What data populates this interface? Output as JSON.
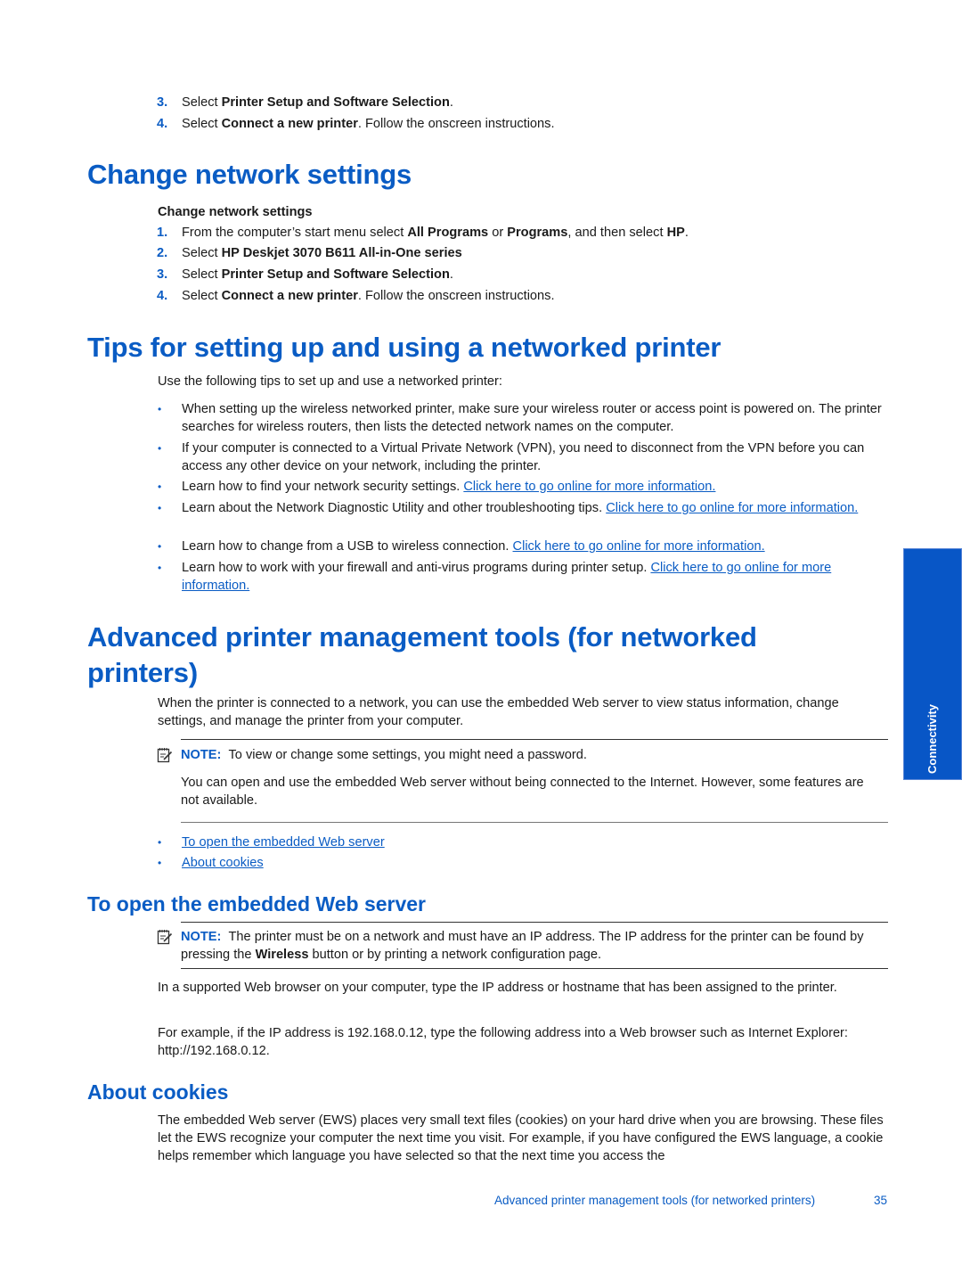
{
  "top_steps": [
    {
      "num": "3.",
      "pre": "Select ",
      "bold": "Printer Setup and Software Selection",
      "post": "."
    },
    {
      "num": "4.",
      "pre": "Select ",
      "bold": "Connect a new printer",
      "post": ". Follow the onscreen instructions."
    }
  ],
  "change_network": {
    "heading": "Change network settings",
    "subheading": "Change network settings",
    "step1": {
      "num": "1.",
      "t1": "From the computer’s start menu select ",
      "b1": "All Programs",
      "t2": " or ",
      "b2": "Programs",
      "t3": ", and then select ",
      "b3": "HP",
      "t4": "."
    },
    "step2": {
      "num": "2.",
      "pre": "Select ",
      "bold": "HP Deskjet 3070 B611 All-in-One series"
    },
    "step3": {
      "num": "3.",
      "pre": "Select ",
      "bold": "Printer Setup and Software Selection",
      "post": "."
    },
    "step4": {
      "num": "4.",
      "pre": "Select ",
      "bold": "Connect a new printer",
      "post": ". Follow the onscreen instructions."
    }
  },
  "tips": {
    "heading": "Tips for setting up and using a networked printer",
    "intro": "Use the following tips to set up and use a networked printer:",
    "bullet_char": "•",
    "items": [
      {
        "text": "When setting up the wireless networked printer, make sure your wireless router or access point is powered on. The printer searches for wireless routers, then lists the detected network names on the computer.",
        "link": ""
      },
      {
        "text": "If your computer is connected to a Virtual Private Network (VPN), you need to disconnect from the VPN before you can access any other device on your network, including the printer.",
        "link": ""
      },
      {
        "text": "Learn how to find your network security settings. ",
        "link": "Click here to go online for more information."
      },
      {
        "text": "Learn about the Network Diagnostic Utility and other troubleshooting tips. ",
        "link": "Click here to go online for more information."
      },
      {
        "text": "Learn how to change from a USB to wireless connection. ",
        "link": "Click here to go online for more information."
      },
      {
        "text": "Learn how to work with your firewall and anti-virus programs during printer setup. ",
        "link": "Click here to go online for more information."
      }
    ]
  },
  "advanced": {
    "heading": "Advanced printer management tools (for networked printers)",
    "intro": "When the printer is connected to a network, you can use the embedded Web server to view status information, change settings, and manage the printer from your computer.",
    "note_label": "NOTE:",
    "note_text": "To view or change some settings, you might need a password.",
    "note_extra": "You can open and use the embedded Web server without being connected to the Internet. However, some features are not available.",
    "links": [
      "To open the embedded Web server",
      "About cookies"
    ]
  },
  "open_ews": {
    "heading": "To open the embedded Web server",
    "note_label": "NOTE:",
    "note_t1": "The printer must be on a network and must have an IP address. The IP address for the printer can be found by pressing the ",
    "note_bold": "Wireless",
    "note_t2": " button or by printing a network configuration page.",
    "para1": "In a supported Web browser on your computer, type the IP address or hostname that has been assigned to the printer.",
    "para2": "For example, if the IP address is 192.168.0.12, type the following address into a Web browser such as Internet Explorer: http://192.168.0.12."
  },
  "cookies": {
    "heading": "About cookies",
    "para": "The embedded Web server (EWS) places very small text files (cookies) on your hard drive when you are browsing. These files let the EWS recognize your computer the next time you visit. For example, if you have configured the EWS language, a cookie helps remember which language you have selected so that the next time you access the"
  },
  "side_tab": {
    "label": "Connectivity",
    "color": "#0856c6"
  },
  "footer": {
    "section": "Advanced printer management tools (for networked printers)",
    "page": "35"
  },
  "accent_color": "#0a5cc4"
}
